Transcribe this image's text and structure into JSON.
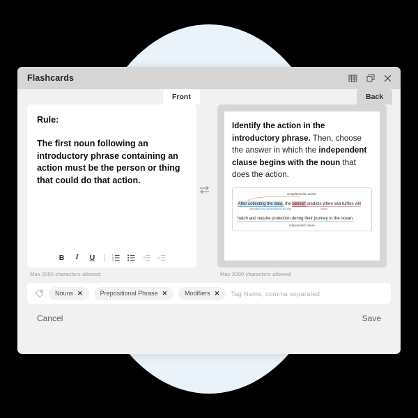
{
  "window": {
    "title": "Flashcards",
    "icons": {
      "grid": "grid-icon",
      "restore": "restore-window-icon",
      "close": "close-icon"
    }
  },
  "tabs": {
    "front_label": "Front",
    "back_label": "Back"
  },
  "front_card": {
    "heading": "Rule:",
    "body": "The first noun following an introductory phrase containing an action must be the person or thing that could do that action.",
    "helper": "Max 2000 characters allowed",
    "toolbar": {
      "bold": "B",
      "italic": "I",
      "underline": "U",
      "ordered_list": "ordered-list-icon",
      "bullet_list": "bullet-list-icon",
      "outdent": "outdent-icon",
      "indent": "indent-icon"
    }
  },
  "back_card": {
    "text_part1": "Identify the action in the introductory phrase.",
    "text_part2": " Then, choose the answer in which the ",
    "text_part3": "independent clause begins with the noun",
    "text_part4": " that does the action.",
    "helper": "Max 2000 characters allowed",
    "diagram": {
      "top_label": "Completes the action:",
      "phrase_highlight": "After collecting the data,",
      "line1_mid": " the ",
      "noun_highlight": "sensor",
      "line1_tail": " predicts when sea turtles will",
      "sub_label_blue": "Introductory prepositional phrase",
      "sub_label_pink": "Noun",
      "line2": "hatch and require protection during their journey to the ocean.",
      "bottom_label": "Independent clause",
      "colors": {
        "blue_highlight": "#cfe6f5",
        "blue_text": "#4b87c7",
        "pink_highlight": "#f0b8c0",
        "pink_text": "#c4515f"
      }
    }
  },
  "swap": {
    "icon": "swap-arrows-icon"
  },
  "tags": {
    "icon": "tag-icon",
    "chips": [
      {
        "label": "Nouns",
        "remove": "✕"
      },
      {
        "label": "Prepositional Phrase",
        "remove": "✕"
      },
      {
        "label": "Modifiers",
        "remove": "✕"
      }
    ],
    "input_value": "",
    "input_placeholder": "Tag Name, comma separated"
  },
  "footer": {
    "cancel_label": "Cancel",
    "save_label": "Save"
  },
  "theme": {
    "background": "#000000",
    "circle": "#eaf3fa",
    "dialog_bg": "#f1f1f1",
    "titlebar_bg": "#d6d6d6"
  }
}
